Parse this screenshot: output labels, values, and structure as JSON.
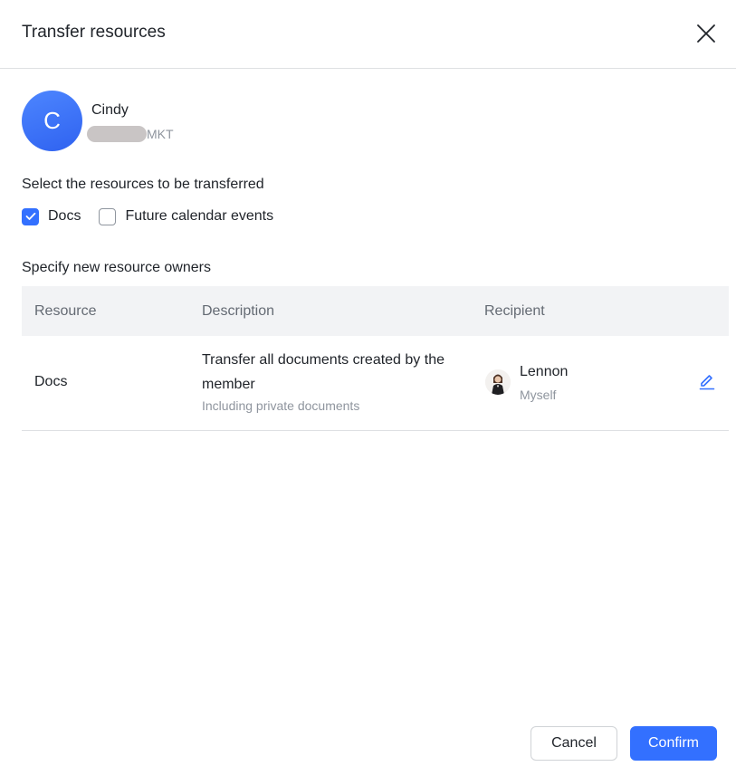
{
  "dialog": {
    "title": "Transfer resources"
  },
  "member": {
    "avatar_initial": "C",
    "name": "Cindy",
    "department": "MKT"
  },
  "select_section": {
    "label": "Select the resources to be transferred",
    "options": [
      {
        "label": "Docs",
        "checked": true
      },
      {
        "label": "Future calendar events",
        "checked": false
      }
    ]
  },
  "owners_section": {
    "label": "Specify new resource owners",
    "columns": [
      "Resource",
      "Description",
      "Recipient"
    ],
    "rows": [
      {
        "resource": "Docs",
        "description_line1": "Transfer all documents created by the",
        "description_line2": "member",
        "description_sub": "Including private documents",
        "recipient_name": "Lennon",
        "recipient_note": "Myself"
      }
    ]
  },
  "footer": {
    "cancel_label": "Cancel",
    "confirm_label": "Confirm"
  },
  "colors": {
    "accent": "#3370ff",
    "text": "#1f2329",
    "muted": "#8f959e"
  }
}
